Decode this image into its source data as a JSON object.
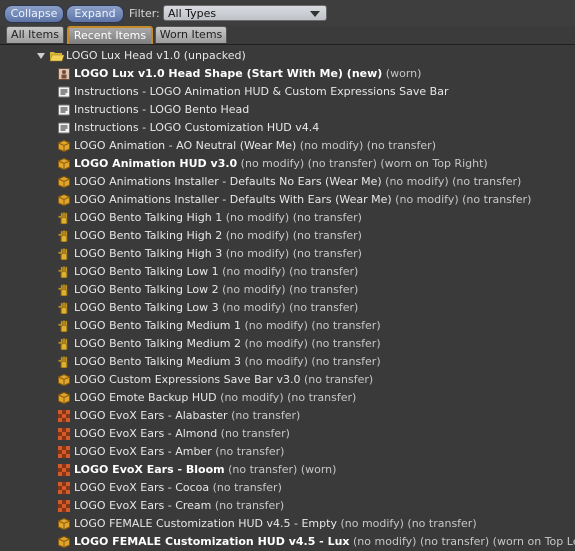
{
  "toolbar": {
    "collapse_label": "Collapse",
    "expand_label": "Expand",
    "filter_label": "Filter:",
    "filter_value": "All Types"
  },
  "tabs": [
    {
      "label": "All Items",
      "active": false
    },
    {
      "label": "Recent Items",
      "active": true
    },
    {
      "label": "Worn Items",
      "active": false
    }
  ],
  "folder": {
    "label": "LOGO Lux Head v1.0 (unpacked)",
    "icon": "open-folder-icon"
  },
  "items": [
    {
      "icon": "shape",
      "name": "LOGO Lux v1.0 Head Shape (Start With Me) (new)",
      "bold": true,
      "suffix": " (worn)"
    },
    {
      "icon": "notecard",
      "name": "Instructions - LOGO Animation HUD & Custom Expressions Save Bar",
      "bold": false,
      "suffix": ""
    },
    {
      "icon": "notecard",
      "name": "Instructions - LOGO Bento Head",
      "bold": false,
      "suffix": ""
    },
    {
      "icon": "notecard",
      "name": "Instructions - LOGO Customization HUD v4.4",
      "bold": false,
      "suffix": ""
    },
    {
      "icon": "object",
      "name": "LOGO Animation - AO Neutral (Wear Me)",
      "bold": false,
      "suffix": " (no modify) (no transfer)"
    },
    {
      "icon": "object",
      "name": "LOGO Animation HUD v3.0",
      "bold": true,
      "suffix": " (no modify) (no transfer) (worn on Top Right)"
    },
    {
      "icon": "object",
      "name": "LOGO Animations Installer - Defaults No Ears (Wear Me)",
      "bold": false,
      "suffix": " (no modify) (no transfer)"
    },
    {
      "icon": "object",
      "name": "LOGO Animations Installer - Defaults With Ears (Wear Me)",
      "bold": false,
      "suffix": " (no modify) (no transfer)"
    },
    {
      "icon": "gesture",
      "name": "LOGO Bento Talking High 1",
      "bold": false,
      "suffix": " (no modify) (no transfer)"
    },
    {
      "icon": "gesture",
      "name": "LOGO Bento Talking High 2",
      "bold": false,
      "suffix": " (no modify) (no transfer)"
    },
    {
      "icon": "gesture",
      "name": "LOGO Bento Talking High 3",
      "bold": false,
      "suffix": " (no modify) (no transfer)"
    },
    {
      "icon": "gesture",
      "name": "LOGO Bento Talking Low 1",
      "bold": false,
      "suffix": " (no modify) (no transfer)"
    },
    {
      "icon": "gesture",
      "name": "LOGO Bento Talking Low 2",
      "bold": false,
      "suffix": " (no modify) (no transfer)"
    },
    {
      "icon": "gesture",
      "name": "LOGO Bento Talking Low 3",
      "bold": false,
      "suffix": " (no modify) (no transfer)"
    },
    {
      "icon": "gesture",
      "name": "LOGO Bento Talking Medium 1",
      "bold": false,
      "suffix": " (no modify) (no transfer)"
    },
    {
      "icon": "gesture",
      "name": "LOGO Bento Talking Medium 2",
      "bold": false,
      "suffix": " (no modify) (no transfer)"
    },
    {
      "icon": "gesture",
      "name": "LOGO Bento Talking Medium 3",
      "bold": false,
      "suffix": " (no modify) (no transfer)"
    },
    {
      "icon": "object",
      "name": "LOGO Custom Expressions Save Bar v3.0",
      "bold": false,
      "suffix": " (no transfer)"
    },
    {
      "icon": "object",
      "name": "LOGO Emote Backup HUD",
      "bold": false,
      "suffix": " (no modify) (no transfer)"
    },
    {
      "icon": "texture",
      "name": "LOGO EvoX Ears - Alabaster",
      "bold": false,
      "suffix": " (no transfer)"
    },
    {
      "icon": "texture",
      "name": "LOGO EvoX Ears - Almond",
      "bold": false,
      "suffix": " (no transfer)"
    },
    {
      "icon": "texture",
      "name": "LOGO EvoX Ears - Amber",
      "bold": false,
      "suffix": " (no transfer)"
    },
    {
      "icon": "texture",
      "name": "LOGO EvoX Ears - Bloom",
      "bold": true,
      "suffix": " (no transfer) (worn)"
    },
    {
      "icon": "texture",
      "name": "LOGO EvoX Ears - Cocoa",
      "bold": false,
      "suffix": " (no transfer)"
    },
    {
      "icon": "texture",
      "name": "LOGO EvoX Ears - Cream",
      "bold": false,
      "suffix": " (no transfer)"
    },
    {
      "icon": "object",
      "name": "LOGO FEMALE Customization HUD v4.5 - Empty",
      "bold": false,
      "suffix": " (no modify) (no transfer)"
    },
    {
      "icon": "object",
      "name": "LOGO FEMALE Customization HUD v4.5 - Lux",
      "bold": true,
      "suffix": " (no modify) (no transfer) (worn on Top Lef"
    }
  ]
}
